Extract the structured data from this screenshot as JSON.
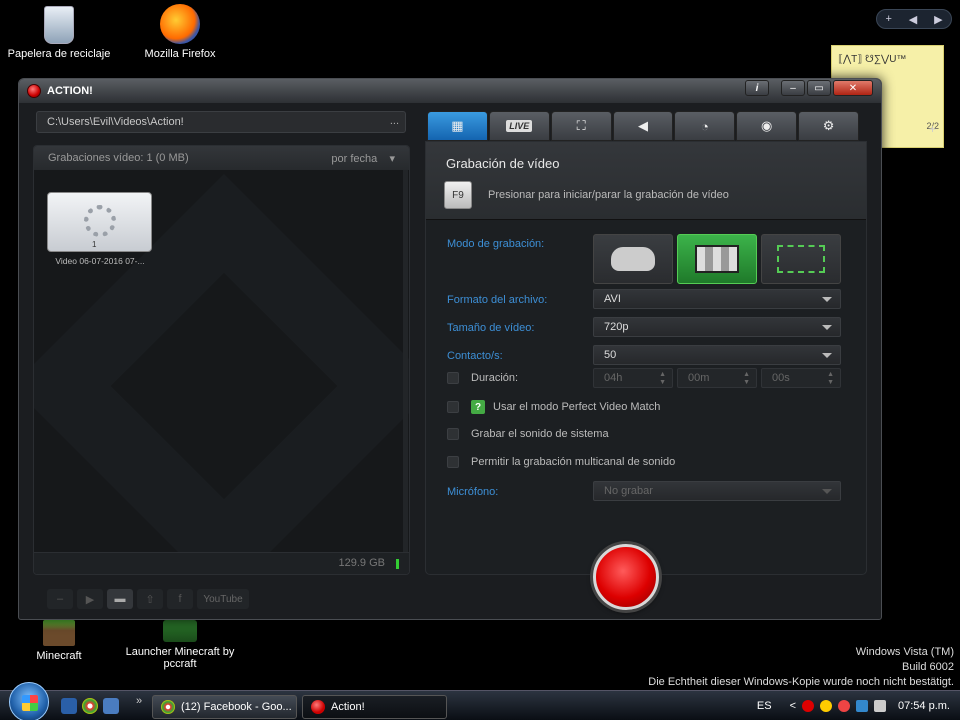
{
  "desktop": {
    "icons": [
      {
        "label": "Papelera de reciclaje"
      },
      {
        "label": "Mozilla Firefox"
      },
      {
        "label": "Minecraft"
      },
      {
        "label": "Launcher Minecraft by pccraft"
      }
    ],
    "watermark": {
      "line1": "Windows Vista (TM)",
      "line2": "Build 6002",
      "line3": "Die Echtheit dieser Windows-Kopie wurde noch nicht bestätigt."
    }
  },
  "sticky_note": {
    "text": "⟦⋀T⟧ ☋∑⋁U™",
    "nav": "2/2",
    "add": "+"
  },
  "window": {
    "title": "ACTION!",
    "info_label": "i",
    "minimize_label": "–",
    "close_label": "✕",
    "path": "C:\\Users\\Evil\\Videos\\Action!",
    "path_button": "...",
    "left_header": "Grabaciones vídeo: 1 (0 MB)",
    "sort_label": "por fecha",
    "thumb_number": "1",
    "thumb_label": "Video 06-07-2016 07-...",
    "free_space": "129.9 GB",
    "youtube_label": "YouTube",
    "tabs": [
      {
        "name": "video",
        "glyph": "▦"
      },
      {
        "name": "live",
        "glyph": "LIVE"
      },
      {
        "name": "benchmark",
        "glyph": "⛶"
      },
      {
        "name": "audio",
        "glyph": "◀"
      },
      {
        "name": "timer",
        "glyph": "◔"
      },
      {
        "name": "screenshot",
        "glyph": "◉"
      },
      {
        "name": "settings",
        "glyph": "⚙"
      }
    ],
    "section_title": "Grabación de vídeo",
    "hotkey": "F9",
    "hotkey_text": "Presionar para iniciar/parar la grabación de vídeo",
    "mode_label": "Modo de grabación:",
    "format_label": "Formato del archivo:",
    "format_value": "AVI",
    "size_label": "Tamaño de vídeo:",
    "size_value": "720p",
    "fps_label": "Contacto/s:",
    "fps_value": "50",
    "duration_label": "Duración:",
    "duration_h": "04h",
    "duration_m": "00m",
    "duration_s": "00s",
    "perfect_label": "Usar el modo Perfect Video Match",
    "system_sound_label": "Grabar el sonido de sistema",
    "multichannel_label": "Permitir la grabación multicanal de sonido",
    "mic_label": "Micrófono:",
    "mic_value": "No grabar"
  },
  "taskbar": {
    "buttons": [
      {
        "label": "(12) Facebook - Goo..."
      },
      {
        "label": "Action!"
      }
    ],
    "chevron": "»",
    "lang": "ES",
    "tray_arrow": "<",
    "time": "07:54 p.m."
  },
  "colors": {
    "accent_blue": "#3d8fd6",
    "record_red": "#dd0000",
    "active_mode_green": "#3cb34a"
  }
}
